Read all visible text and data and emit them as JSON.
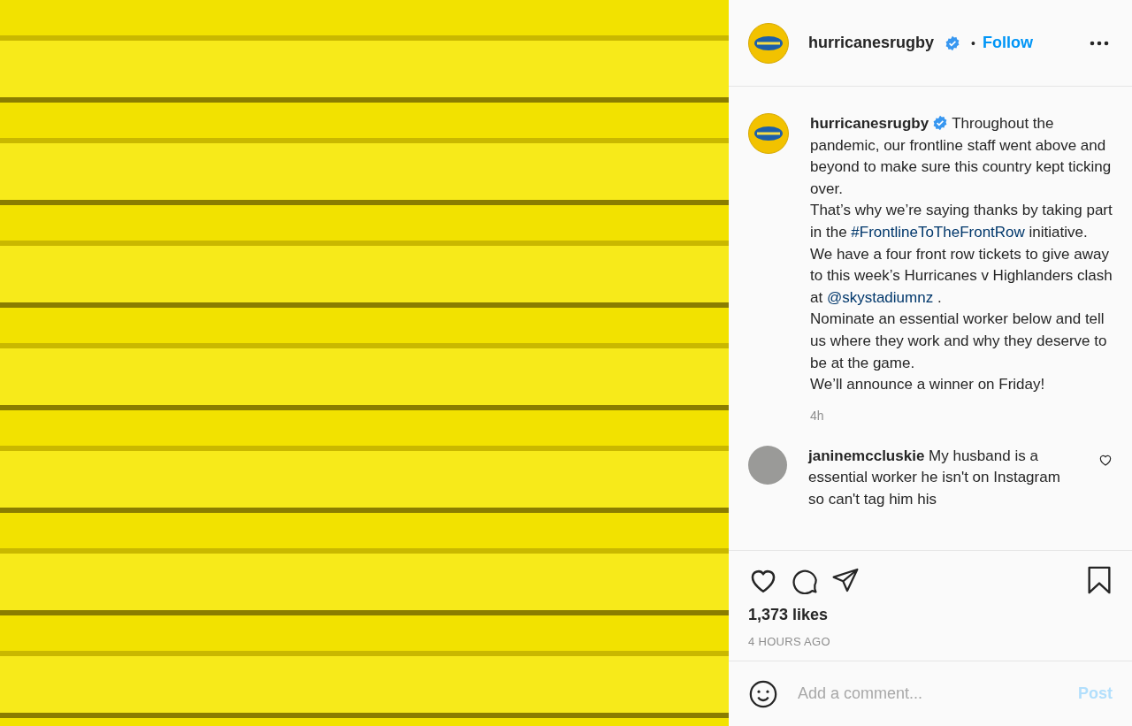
{
  "header": {
    "username": "hurricanesrugby",
    "verified": true,
    "separator": "•",
    "follow": "Follow"
  },
  "caption": {
    "username": "hurricanesrugby",
    "verified": true,
    "paragraphs": [
      [
        {
          "kind": "text",
          "text": "Throughout the pandemic, our frontline staff went above and beyond to make sure this country kept ticking over."
        }
      ],
      [
        {
          "kind": "text",
          "text": "That’s why we’re saying thanks by taking part in the "
        },
        {
          "kind": "link",
          "text": "#FrontlineToTheFrontRow"
        },
        {
          "kind": "text",
          "text": " initiative."
        }
      ],
      [
        {
          "kind": "text",
          "text": "We have a four front row tickets to give away to this week’s Hurricanes v Highlanders clash at "
        },
        {
          "kind": "link",
          "text": "@skystadiumnz"
        },
        {
          "kind": "text",
          "text": " ."
        }
      ],
      [
        {
          "kind": "text",
          "text": "Nominate an essential worker below and tell us where they work and why they deserve to be at the game."
        }
      ],
      [
        {
          "kind": "text",
          "text": "We’ll announce a winner on Friday!"
        }
      ]
    ],
    "time": "4h"
  },
  "comments": [
    {
      "username": "janinemccluskie",
      "text": "My husband is a essential worker he isn't on Instagram so can't tag him his",
      "liked": false
    }
  ],
  "actions": {
    "liked": false,
    "saved": false
  },
  "likes": "1,373 likes",
  "timestamp": "4 HOURS AGO",
  "comment_box": {
    "placeholder": "Add a comment...",
    "post": "Post",
    "disabled": true
  }
}
